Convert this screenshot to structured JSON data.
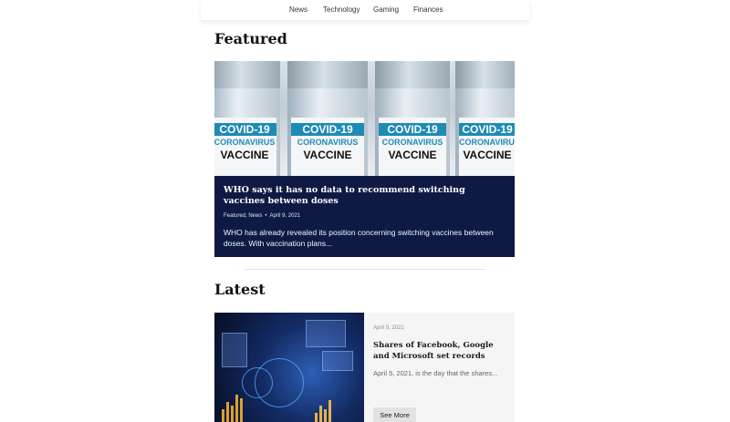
{
  "nav": {
    "items": [
      "News",
      "Technology",
      "Gaming",
      "Finances"
    ]
  },
  "sections": {
    "featured_title": "Featured",
    "latest_title": "Latest"
  },
  "featured": {
    "image_labels": {
      "covid": "COVID-19",
      "coronavirus": "CORONAVIRUS",
      "vaccine": "VACCINE"
    },
    "headline": "WHO says it has no data to recommend switching vaccines between doses",
    "categories": "Featured, News",
    "date": "April 9, 2021",
    "excerpt": "WHO has already revealed its position concerning switching vaccines between doses. With vaccination plans..."
  },
  "latest": {
    "date": "April 9, 2021",
    "headline": "Shares of Facebook, Google and Microsoft set records",
    "excerpt": "April 5, 2021, is the day that the shares...",
    "button_label": "See More"
  },
  "colors": {
    "featured_bg": "#0f1a44",
    "vaccine_blue": "#1f8bb5",
    "card_bg": "#f5f5f5"
  }
}
